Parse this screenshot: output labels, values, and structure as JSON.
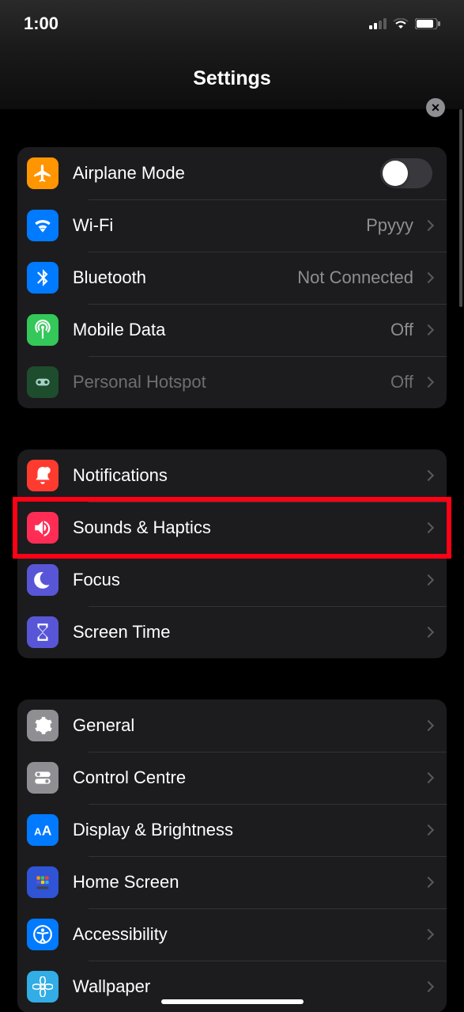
{
  "status": {
    "time": "1:00"
  },
  "header": {
    "title": "Settings"
  },
  "groups": [
    {
      "rows": [
        {
          "icon": "airplane",
          "color": "#ff9500",
          "label": "Airplane Mode",
          "type": "toggle",
          "on": false
        },
        {
          "icon": "wifi",
          "color": "#007aff",
          "label": "Wi-Fi",
          "value": "Ppyyy",
          "type": "nav"
        },
        {
          "icon": "bluetooth",
          "color": "#007aff",
          "label": "Bluetooth",
          "value": "Not Connected",
          "type": "nav"
        },
        {
          "icon": "antenna",
          "color": "#34c759",
          "label": "Mobile Data",
          "value": "Off",
          "type": "nav"
        },
        {
          "icon": "hotspot",
          "color": "#1f5a31",
          "label": "Personal Hotspot",
          "value": "Off",
          "type": "nav",
          "disabled": true
        }
      ]
    },
    {
      "rows": [
        {
          "icon": "bell",
          "color": "#ff3b30",
          "label": "Notifications",
          "type": "nav"
        },
        {
          "icon": "speaker",
          "color": "#ff2d55",
          "label": "Sounds & Haptics",
          "type": "nav",
          "highlight": true
        },
        {
          "icon": "moon",
          "color": "#5856d6",
          "label": "Focus",
          "type": "nav"
        },
        {
          "icon": "hourglass",
          "color": "#5856d6",
          "label": "Screen Time",
          "type": "nav"
        }
      ]
    },
    {
      "rows": [
        {
          "icon": "gear",
          "color": "#8e8e93",
          "label": "General",
          "type": "nav"
        },
        {
          "icon": "switches",
          "color": "#8e8e93",
          "label": "Control Centre",
          "type": "nav"
        },
        {
          "icon": "aa",
          "color": "#007aff",
          "label": "Display & Brightness",
          "type": "nav"
        },
        {
          "icon": "grid",
          "color": "#2f54d6",
          "label": "Home Screen",
          "type": "nav"
        },
        {
          "icon": "accessibility",
          "color": "#007aff",
          "label": "Accessibility",
          "type": "nav"
        },
        {
          "icon": "flower",
          "color": "#32ade6",
          "label": "Wallpaper",
          "type": "nav"
        }
      ]
    }
  ]
}
